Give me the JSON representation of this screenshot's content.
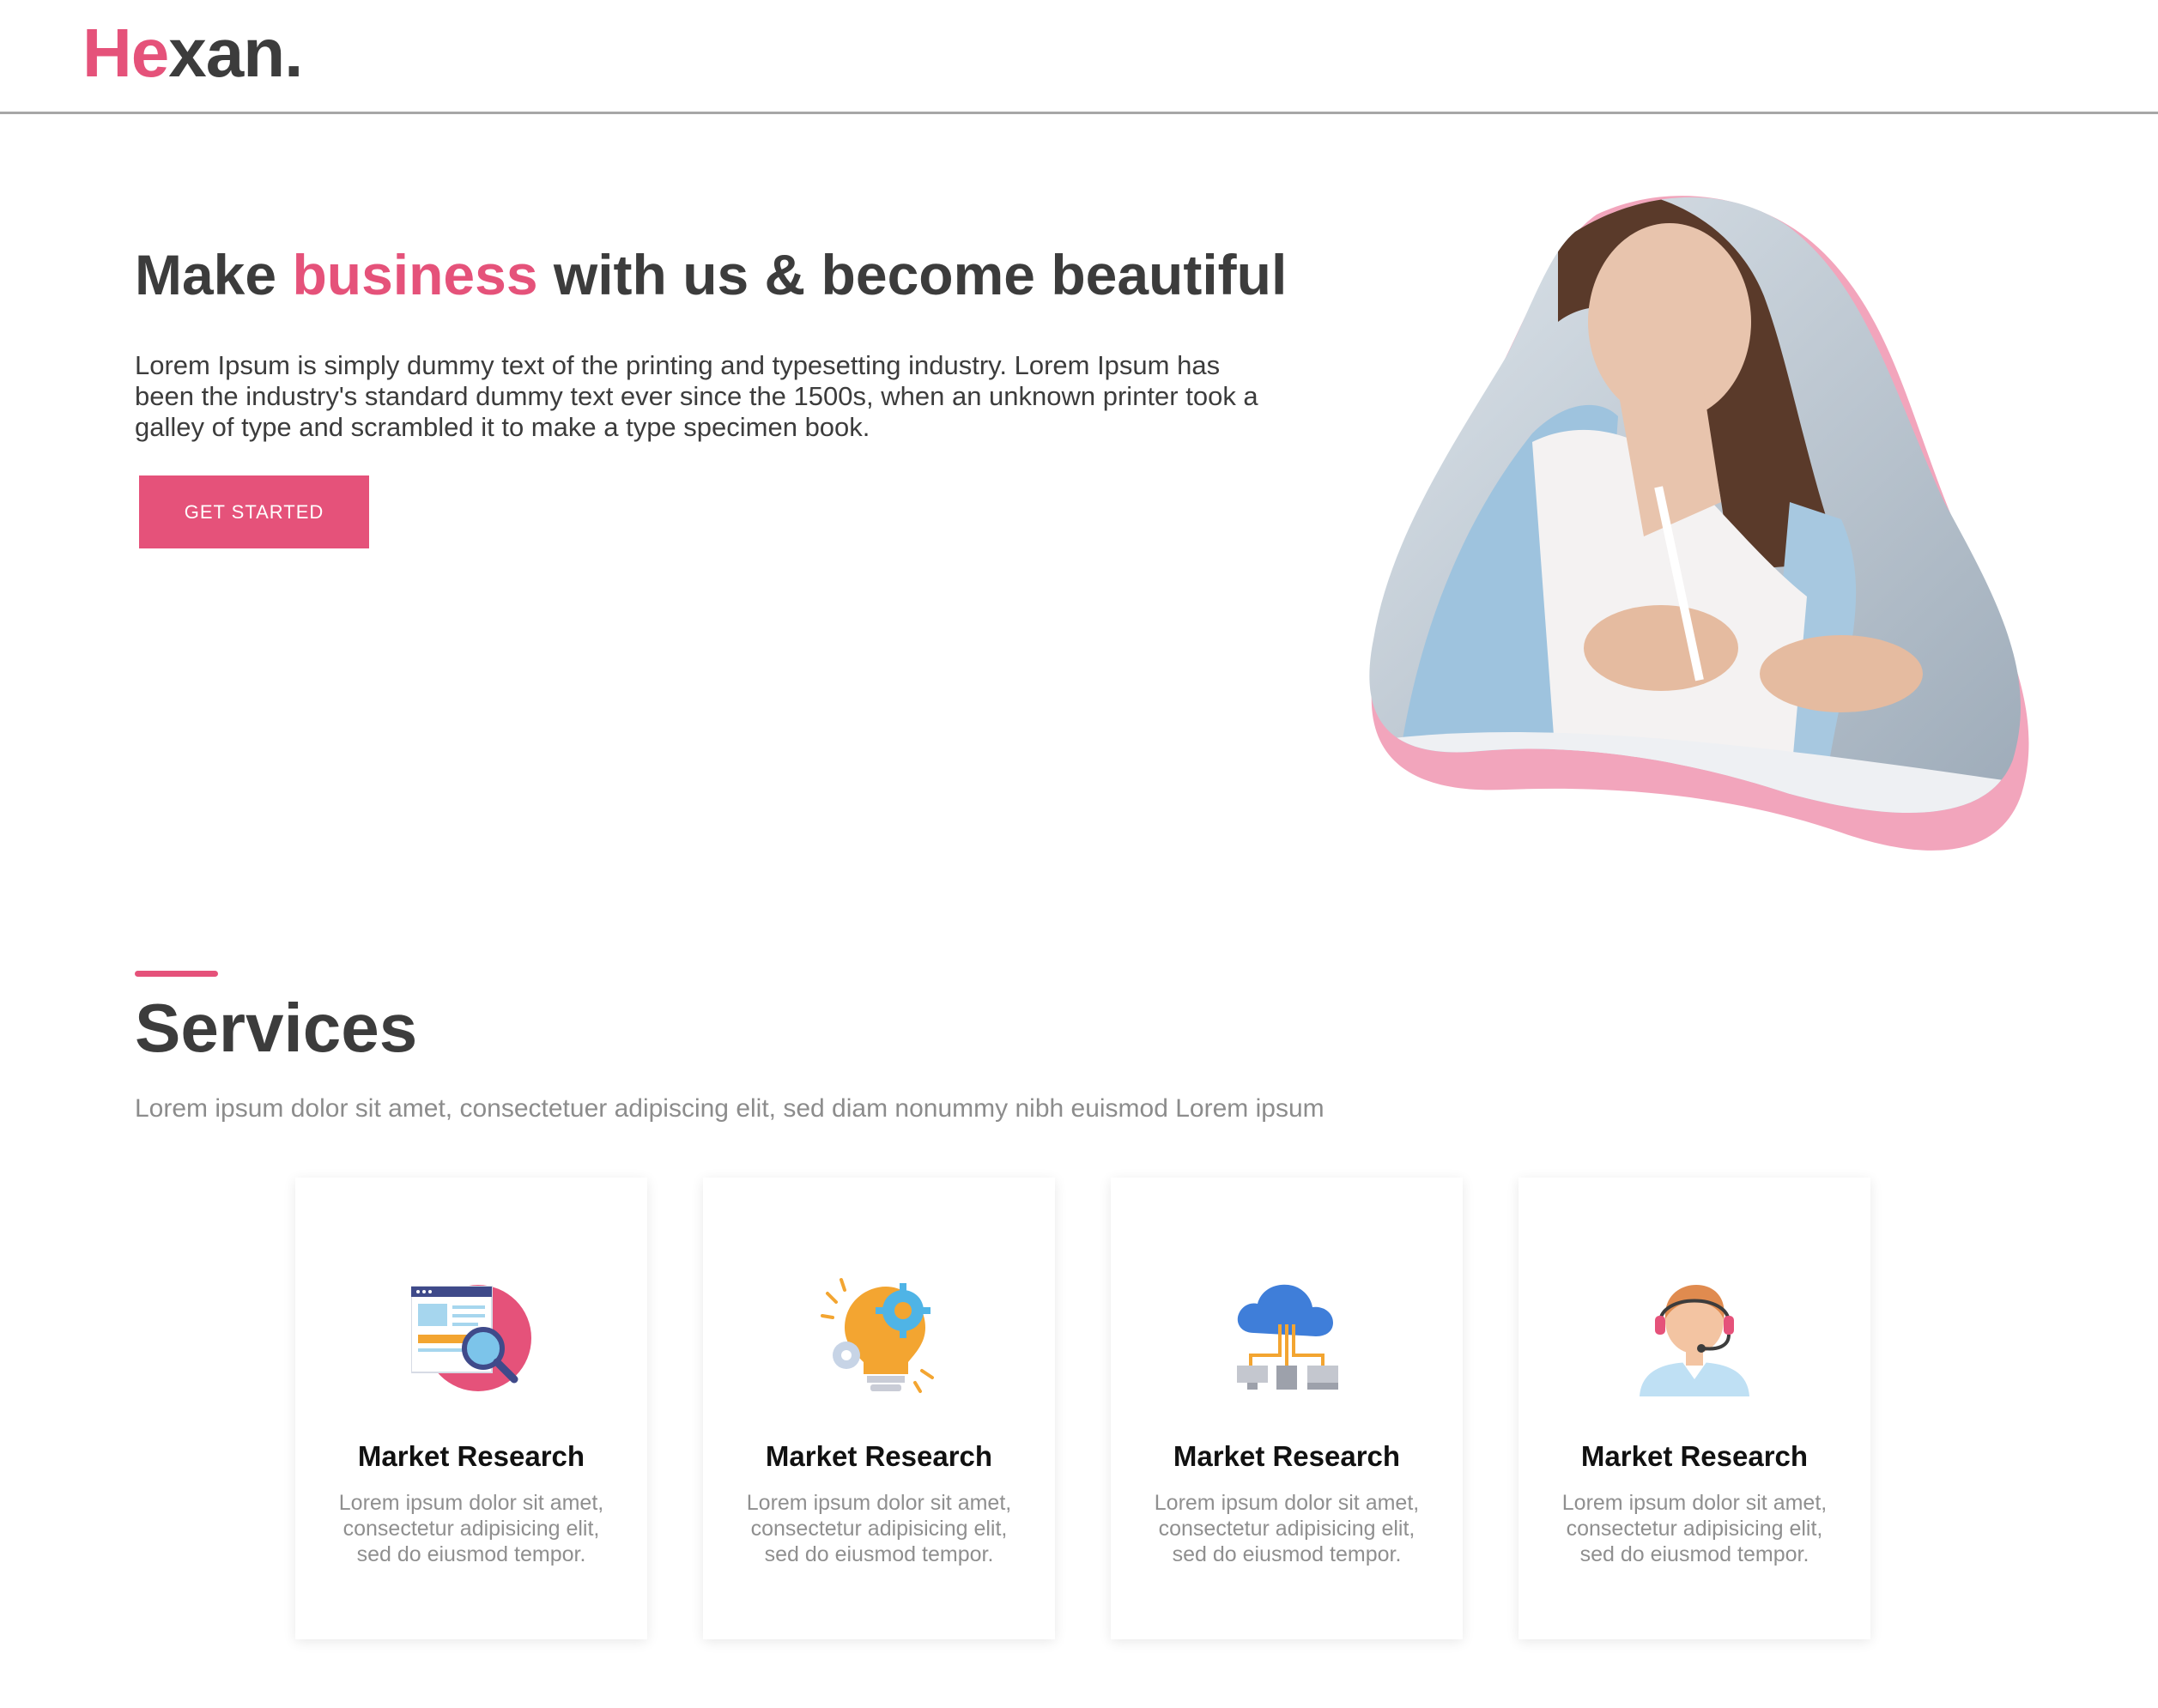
{
  "brand": {
    "part1": "He",
    "part2": "xan",
    "part3": "",
    "dot": "."
  },
  "hero": {
    "title_before": "Make ",
    "title_accent": "business",
    "title_after": " with us & become beautiful",
    "text": "Lorem Ipsum is simply dummy text of the printing and typesetting industry. Lorem Ipsum has been the industry's standard dummy text ever since the 1500s, when an unknown printer took a galley of type and scrambled it to make a type specimen book.",
    "cta_label": "GET STARTED"
  },
  "services": {
    "title": "Services",
    "subtitle": "Lorem ipsum dolor sit amet, consectetuer adipiscing elit, sed diam nonummy nibh euismod Lorem ipsum",
    "cards": [
      {
        "icon": "market-research-icon",
        "title": "Market Research",
        "text": "Lorem ipsum dolor sit amet, consectetur adipisicing elit, sed do eiusmod tempor."
      },
      {
        "icon": "idea-gear-icon",
        "title": "Market Research",
        "text": "Lorem ipsum dolor sit amet, consectetur adipisicing elit, sed do eiusmod tempor."
      },
      {
        "icon": "cloud-network-icon",
        "title": "Market Research",
        "text": "Lorem ipsum dolor sit amet, consectetur adipisicing elit, sed do eiusmod tempor."
      },
      {
        "icon": "support-agent-icon",
        "title": "Market Research",
        "text": "Lorem ipsum dolor sit amet, consectetur adipisicing elit, sed do eiusmod tempor."
      }
    ]
  },
  "colors": {
    "accent": "#e5527a",
    "text": "#3c3c3c",
    "muted": "#8c8c8c"
  }
}
